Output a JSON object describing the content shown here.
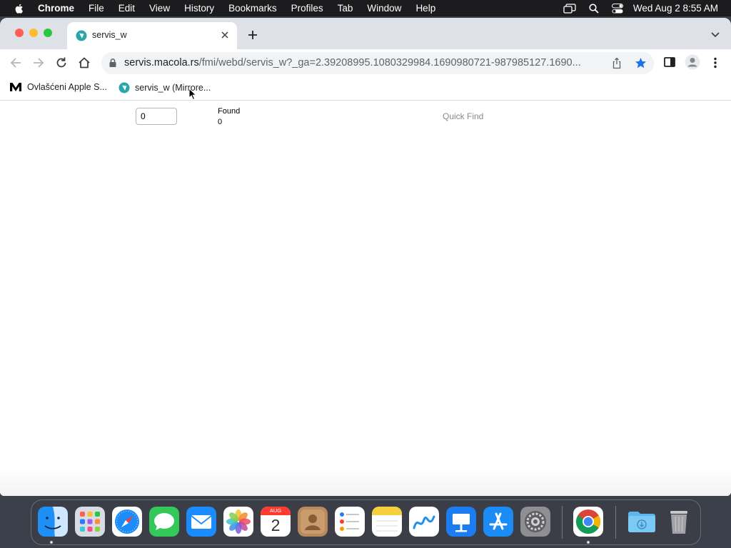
{
  "menubar": {
    "app_name": "Chrome",
    "items": [
      "File",
      "Edit",
      "View",
      "History",
      "Bookmarks",
      "Profiles",
      "Tab",
      "Window",
      "Help"
    ],
    "clock": "Wed Aug 2  8:55 AM"
  },
  "tab": {
    "title": "servis_w"
  },
  "omnibox": {
    "url_host": "servis.macola.rs",
    "url_path": "/fmi/webd/servis_w?_ga=2.39208995.1080329984.1690980721-987985127.1690..."
  },
  "bookmarks": [
    {
      "label": "Ovlašćeni Apple S...",
      "icon": "m-logo-icon"
    },
    {
      "label": "servis_w (Mirrore...",
      "icon": "filemaker-icon"
    }
  ],
  "page": {
    "input_value": "0",
    "found_label": "Found",
    "found_count": "0",
    "quick_find_label": "Quick Find"
  },
  "dock": {
    "calendar_month": "AUG",
    "calendar_day": "2",
    "apps": [
      "finder-icon",
      "launchpad-icon",
      "safari-icon",
      "messages-icon",
      "mail-icon",
      "photos-icon",
      "calendar-icon",
      "contacts-icon",
      "reminders-icon",
      "notes-icon",
      "freeform-icon",
      "keynote-icon",
      "app-store-icon",
      "system-settings-icon",
      "chrome-icon",
      "downloads-folder-icon",
      "trash-icon"
    ]
  },
  "colors": {
    "menubar_bg": "#1c1c1e",
    "tabstrip_bg": "#dee1e6",
    "accent_blue": "#1a73e8"
  }
}
